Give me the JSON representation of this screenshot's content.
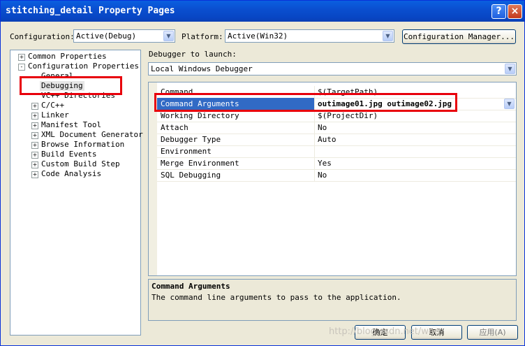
{
  "window": {
    "title": "stitching_detail Property Pages",
    "help_glyph": "?",
    "close_glyph": "×"
  },
  "config": {
    "label": "Configuration:",
    "value": "Active(Debug)"
  },
  "platform": {
    "label": "Platform:",
    "value": "Active(Win32)"
  },
  "config_manager_label": "Configuration Manager...",
  "tree": {
    "items": [
      {
        "label": "Common Properties",
        "expander": "+"
      },
      {
        "label": "Configuration Properties",
        "expander": "-"
      },
      {
        "label": "General"
      },
      {
        "label": "Debugging"
      },
      {
        "label": "VC++ Directories"
      },
      {
        "label": "C/C++",
        "expander": "+"
      },
      {
        "label": "Linker",
        "expander": "+"
      },
      {
        "label": "Manifest Tool",
        "expander": "+"
      },
      {
        "label": "XML Document Generator",
        "expander": "+"
      },
      {
        "label": "Browse Information",
        "expander": "+"
      },
      {
        "label": "Build Events",
        "expander": "+"
      },
      {
        "label": "Custom Build Step",
        "expander": "+"
      },
      {
        "label": "Code Analysis",
        "expander": "+"
      }
    ]
  },
  "debugger": {
    "label": "Debugger to launch:",
    "value": "Local Windows Debugger"
  },
  "properties": [
    {
      "name": "Command",
      "value": "$(TargetPath)"
    },
    {
      "name": "Command Arguments",
      "value": "outimage01.jpg outimage02.jpg"
    },
    {
      "name": "Working Directory",
      "value": "$(ProjectDir)"
    },
    {
      "name": "Attach",
      "value": "No"
    },
    {
      "name": "Debugger Type",
      "value": "Auto"
    },
    {
      "name": "Environment",
      "value": ""
    },
    {
      "name": "Merge Environment",
      "value": "Yes"
    },
    {
      "name": "SQL Debugging",
      "value": "No"
    }
  ],
  "description": {
    "title": "Command Arguments",
    "text": "The command line arguments to pass to the application."
  },
  "buttons": {
    "ok": "确定",
    "cancel": "取消",
    "apply": "应用(A)"
  },
  "watermark": "http://blog.csdn.net/wee",
  "colors": {
    "title_bar": "#0a4fd0",
    "selection": "#316ac5",
    "highlight_box": "#e8000b"
  }
}
